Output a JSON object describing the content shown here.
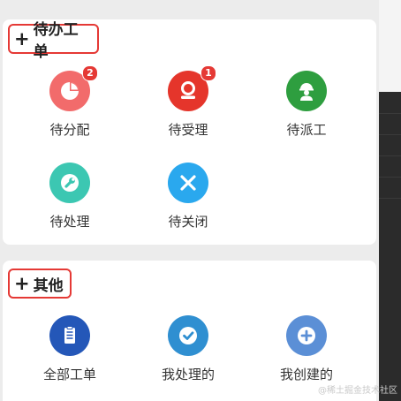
{
  "sections": [
    {
      "title": "待办工单",
      "items": [
        {
          "label": "待分配",
          "icon": "pie-chart-icon",
          "color": "#f26b6b",
          "badge": "2"
        },
        {
          "label": "待受理",
          "icon": "location-pin-icon",
          "color": "#e5352b",
          "badge": "1"
        },
        {
          "label": "待派工",
          "icon": "worker-helmet-icon",
          "color": "#2e9e3f",
          "badge": null
        },
        {
          "label": "待处理",
          "icon": "wrench-icon",
          "color": "#3cc7b2",
          "badge": null
        },
        {
          "label": "待关闭",
          "icon": "close-x-icon",
          "color": "#2aa8ee",
          "badge": null
        }
      ]
    },
    {
      "title": "其他",
      "items": [
        {
          "label": "全部工单",
          "icon": "document-list-icon",
          "color": "#2457b8",
          "badge": null
        },
        {
          "label": "我处理的",
          "icon": "check-circle-icon",
          "color": "#2f8fd1",
          "badge": null
        },
        {
          "label": "我创建的",
          "icon": "plus-circle-icon",
          "color": "#5b8fd6",
          "badge": null
        }
      ]
    }
  ],
  "watermark": "@稀土掘金技术社区"
}
